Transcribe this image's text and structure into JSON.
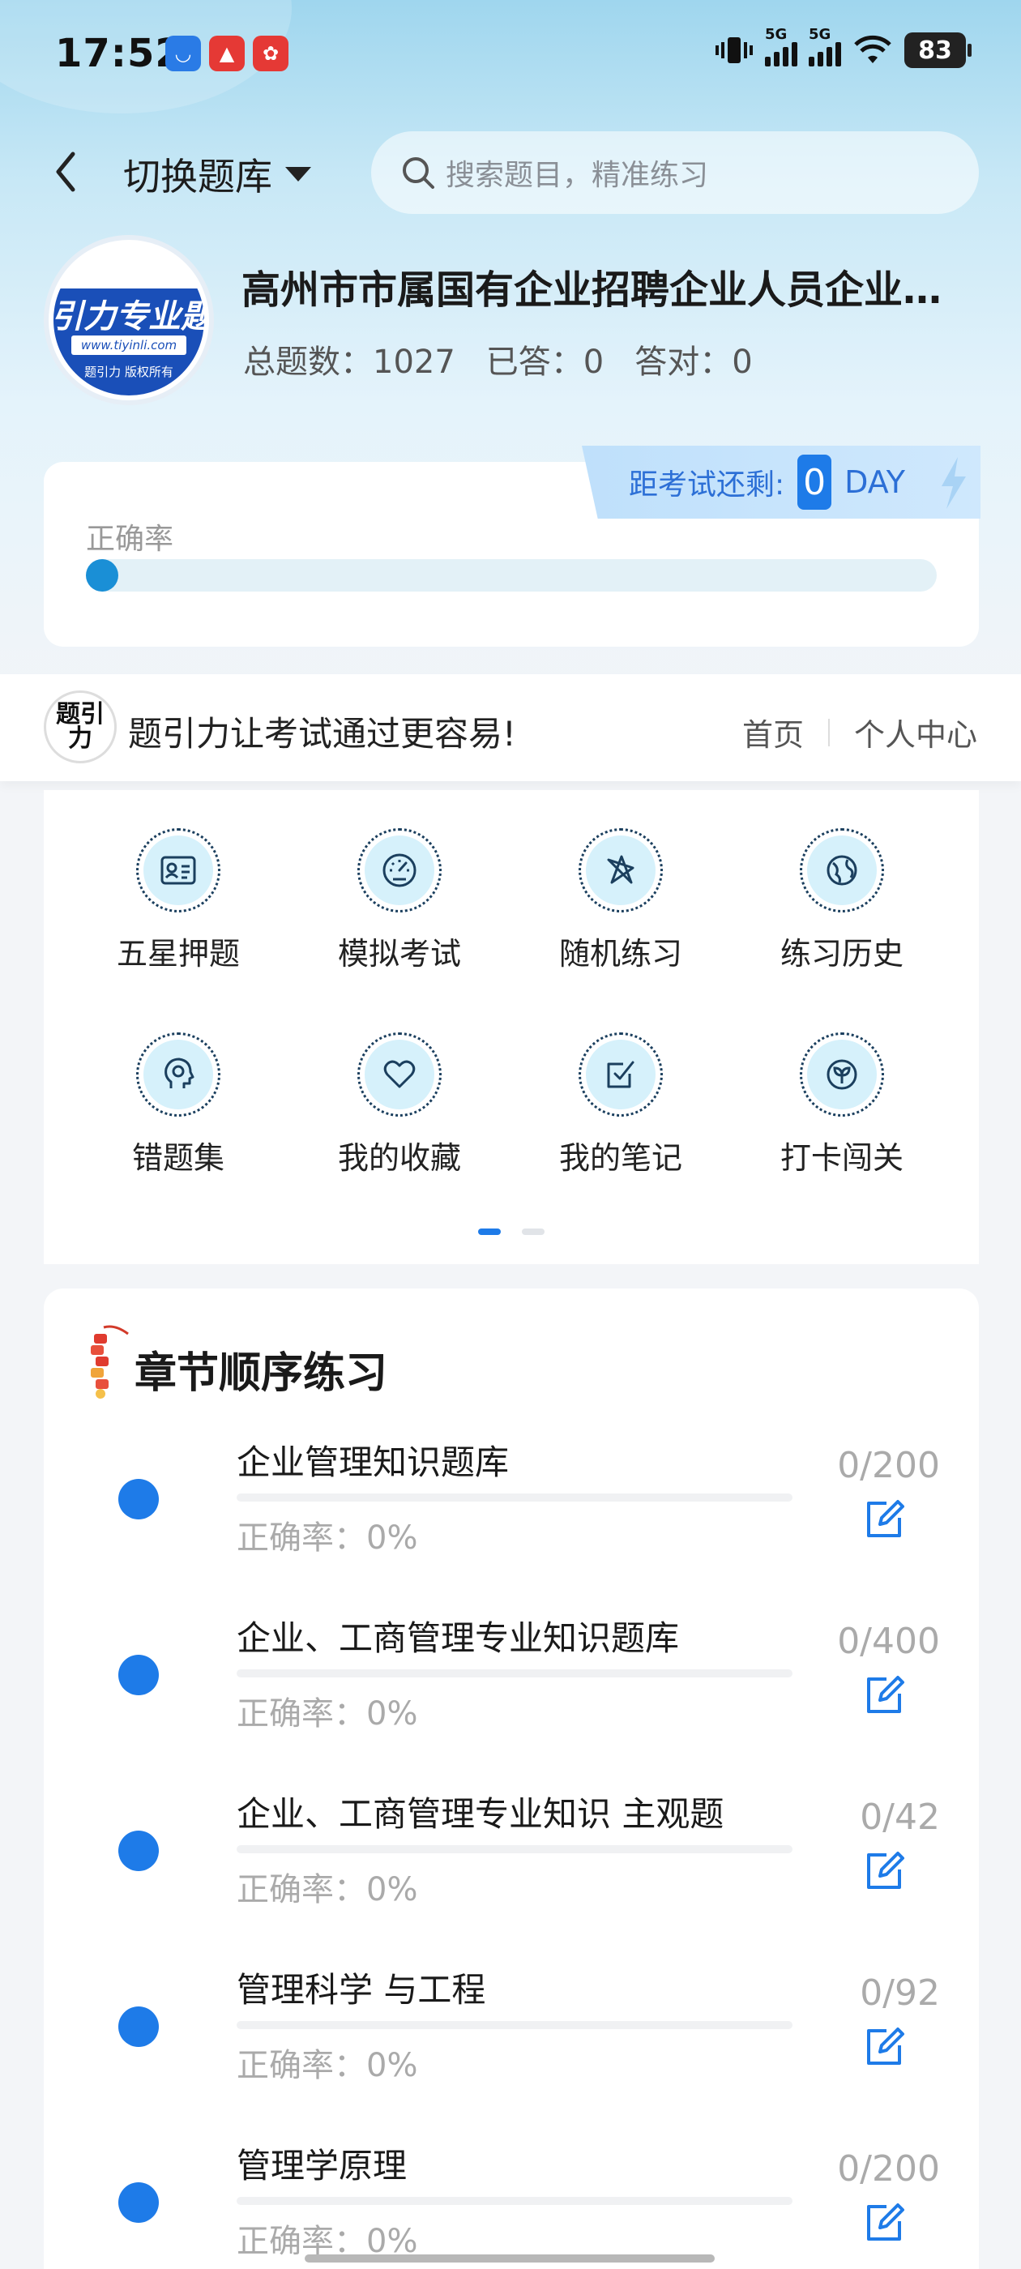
{
  "status_bar": {
    "time": "17:52",
    "battery": "83",
    "network_1": "5G",
    "network_2": "5G"
  },
  "header": {
    "switch_label": "切换题库",
    "search_placeholder": "搜索题目，精准练习"
  },
  "bank": {
    "logo_main": "引力专业题",
    "logo_url": "www.tiyinli.com",
    "logo_copy": "题引力 版权所有",
    "title": "高州市市属国有企业招聘企业人员企业管理题库",
    "total_label": "总题数：1027",
    "answered_label": "已答：0",
    "correct_label": "答对：0"
  },
  "countdown": {
    "label": "距考试还剩:",
    "value": "0",
    "unit": "DAY"
  },
  "accuracy": {
    "label": "正确率",
    "value": 0
  },
  "slogan": {
    "logo_text": "题引力",
    "text": "题引力让考试通过更容易!",
    "link_home": "首页",
    "link_profile": "个人中心"
  },
  "features": [
    {
      "label": "五星押题",
      "icon": "id-card-icon"
    },
    {
      "label": "模拟考试",
      "icon": "speedometer-icon"
    },
    {
      "label": "随机练习",
      "icon": "random-icon"
    },
    {
      "label": "练习历史",
      "icon": "globe-icon"
    },
    {
      "label": "错题集",
      "icon": "head-icon"
    },
    {
      "label": "我的收藏",
      "icon": "heart-icon"
    },
    {
      "label": "我的笔记",
      "icon": "note-check-icon"
    },
    {
      "label": "打卡闯关",
      "icon": "sprout-icon"
    }
  ],
  "pager": {
    "pages": 2,
    "active": 0
  },
  "chapters": {
    "title": "章节顺序练习",
    "items": [
      {
        "name": "企业管理知识题库",
        "accuracy": "正确率：0%",
        "count": "0/200"
      },
      {
        "name": "企业、工商管理专业知识题库",
        "accuracy": "正确率：0%",
        "count": "0/400"
      },
      {
        "name": "企业、工商管理专业知识 主观题",
        "accuracy": "正确率：0%",
        "count": "0/42"
      },
      {
        "name": "管理科学 与工程",
        "accuracy": "正确率：0%",
        "count": "0/92"
      },
      {
        "name": "管理学原理",
        "accuracy": "正确率：0%",
        "count": "0/200"
      }
    ]
  },
  "colors": {
    "accent": "#1e7be8",
    "icon_bg": "#d6f1fb",
    "icon_stroke": "#1b3f5e"
  }
}
